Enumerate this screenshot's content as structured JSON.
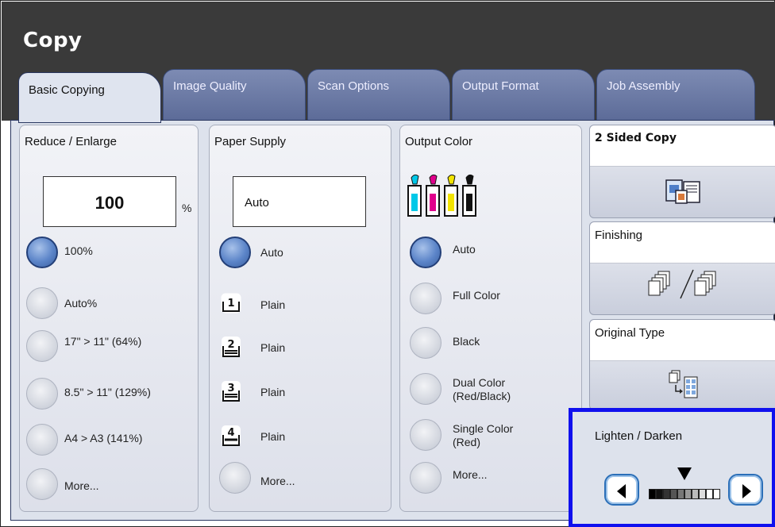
{
  "app": {
    "title": "Copy"
  },
  "tabs": [
    {
      "label": "Basic Copying",
      "active": true
    },
    {
      "label": "Image Quality",
      "active": false
    },
    {
      "label": "Scan Options",
      "active": false
    },
    {
      "label": "Output Format",
      "active": false
    },
    {
      "label": "Job Assembly",
      "active": false
    }
  ],
  "reduce_enlarge": {
    "title": "Reduce / Enlarge",
    "value": "100",
    "unit": "%",
    "options": [
      {
        "label": "100%",
        "selected": true
      },
      {
        "label": "Auto%",
        "selected": false
      },
      {
        "label": "17\" > 11\" (64%)",
        "selected": false
      },
      {
        "label": "8.5\" > 11\" (129%)",
        "selected": false
      },
      {
        "label": "A4 > A3 (141%)",
        "selected": false
      },
      {
        "label": "More...",
        "selected": false
      }
    ]
  },
  "paper_supply": {
    "title": "Paper Supply",
    "value": "Auto",
    "options": [
      {
        "label": "Auto",
        "selected": true,
        "tray": ""
      },
      {
        "label": "Plain",
        "selected": false,
        "tray": "1"
      },
      {
        "label": "Plain",
        "selected": false,
        "tray": "2"
      },
      {
        "label": "Plain",
        "selected": false,
        "tray": "3"
      },
      {
        "label": "Plain",
        "selected": false,
        "tray": "4"
      },
      {
        "label": "More...",
        "selected": false,
        "tray": ""
      }
    ]
  },
  "output_color": {
    "title": "Output Color",
    "toner_colors": [
      "#00c8e8",
      "#e0008c",
      "#f2e400",
      "#111111"
    ],
    "options": [
      {
        "label": "Auto",
        "selected": true
      },
      {
        "label": "Full Color",
        "selected": false
      },
      {
        "label": "Black",
        "selected": false
      },
      {
        "label": "Dual Color\n(Red/Black)",
        "selected": false
      },
      {
        "label": "Single Color\n(Red)",
        "selected": false
      },
      {
        "label": "More...",
        "selected": false
      }
    ]
  },
  "features": {
    "two_sided": {
      "title": "2 Sided Copy",
      "icon": "two-sided-copy-icon"
    },
    "finishing": {
      "title": "Finishing",
      "icon": "finishing-collate-icon"
    },
    "original_type": {
      "title": "Original Type",
      "icon": "original-type-icon"
    },
    "lighten_darken": {
      "title": "Lighten / Darken",
      "level": 0.5,
      "highlight_color": "#1010ee"
    }
  },
  "colors": {
    "header": "#3a3a3a",
    "tab_inactive": "#6b79a4",
    "selected_radio": "#5b84c8"
  }
}
